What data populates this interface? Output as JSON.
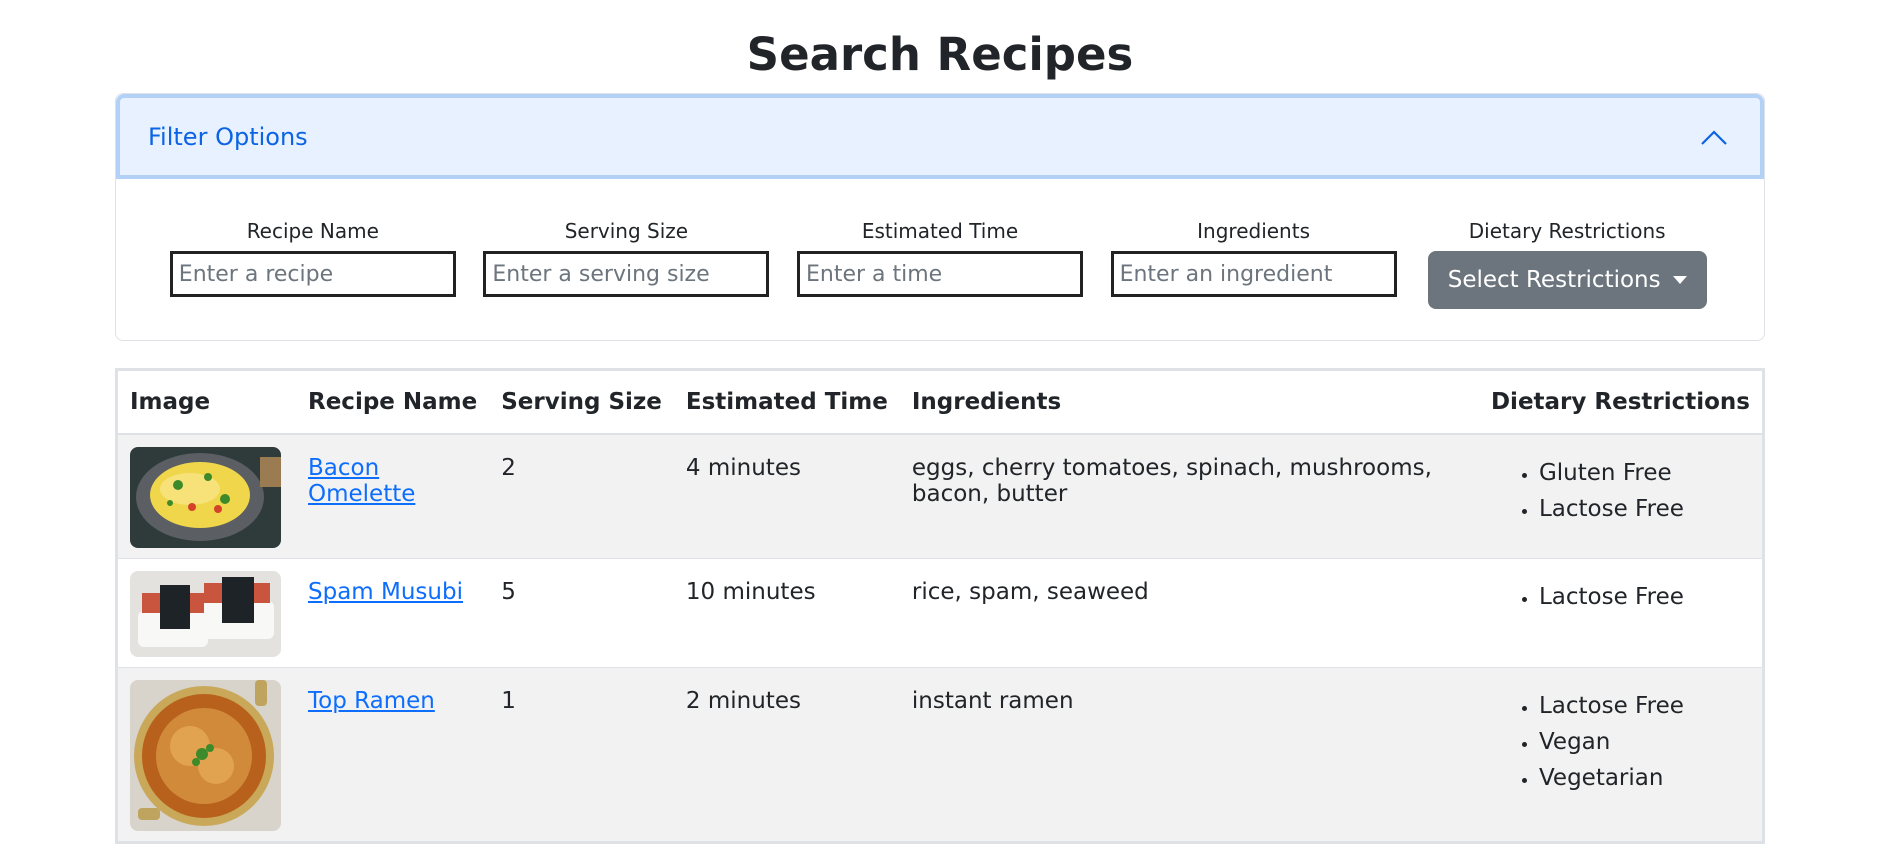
{
  "page": {
    "title": "Search Recipes"
  },
  "filter": {
    "header": "Filter Options",
    "fields": [
      {
        "label": "Recipe Name",
        "placeholder": "Enter a recipe",
        "value": ""
      },
      {
        "label": "Serving Size",
        "placeholder": "Enter a serving size",
        "value": ""
      },
      {
        "label": "Estimated Time",
        "placeholder": "Enter a time",
        "value": ""
      },
      {
        "label": "Ingredients",
        "placeholder": "Enter an ingredient",
        "value": ""
      }
    ],
    "dietary": {
      "label": "Dietary Restrictions",
      "button": "Select Restrictions"
    }
  },
  "table": {
    "headers": [
      "Image",
      "Recipe Name",
      "Serving Size",
      "Estimated Time",
      "Ingredients",
      "Dietary Restrictions"
    ],
    "rows": [
      {
        "image": "omelette-photo",
        "name": "Bacon Omelette",
        "serving": "2",
        "time": "4 minutes",
        "ingredients": "eggs, cherry tomatoes, spinach, mushrooms, bacon, butter",
        "restrictions": [
          "Gluten Free",
          "Lactose Free"
        ]
      },
      {
        "image": "musubi-photo",
        "name": "Spam Musubi",
        "serving": "5",
        "time": "10 minutes",
        "ingredients": "rice, spam, seaweed",
        "restrictions": [
          "Lactose Free"
        ]
      },
      {
        "image": "ramen-photo",
        "name": "Top Ramen",
        "serving": "1",
        "time": "2 minutes",
        "ingredients": "instant ramen",
        "restrictions": [
          "Lactose Free",
          "Vegan",
          "Vegetarian"
        ]
      }
    ]
  },
  "colors": {
    "accent": "#0d6efd",
    "header_bg": "#e7f1ff",
    "button_bg": "#6c757d"
  }
}
